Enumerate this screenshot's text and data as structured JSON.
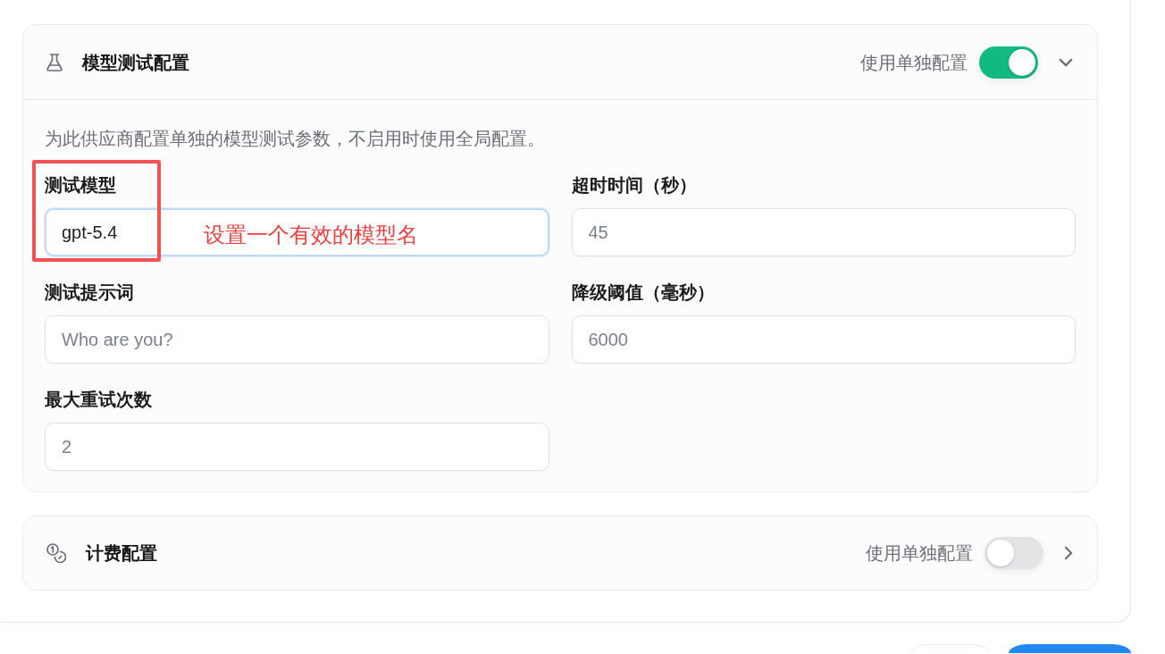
{
  "sections": [
    {
      "kind": "test",
      "title": "模型测试配置",
      "override_label": "使用单独配置",
      "override_on": true,
      "expanded": true,
      "description": "为此供应商配置单独的模型测试参数，不启用时使用全局配置。",
      "fields": [
        {
          "label": "测试模型",
          "value": "gpt-5.4",
          "focused": true,
          "annotation": {
            "text": "设置一个有效的模型名"
          }
        },
        {
          "label": "超时时间（秒）",
          "placeholder": "45",
          "focused": false
        },
        {
          "label": "测试提示词",
          "placeholder": "Who are you?",
          "focused": false
        },
        {
          "label": "降级阈值（毫秒）",
          "placeholder": "6000",
          "focused": false
        },
        {
          "label": "最大重试次数",
          "placeholder": "2",
          "focused": false
        }
      ]
    },
    {
      "kind": "billing",
      "title": "计费配置",
      "override_label": "使用单独配置",
      "override_on": false,
      "expanded": false
    }
  ],
  "footer_buttons": [
    {
      "kind": "outline"
    },
    {
      "kind": "primary"
    }
  ]
}
